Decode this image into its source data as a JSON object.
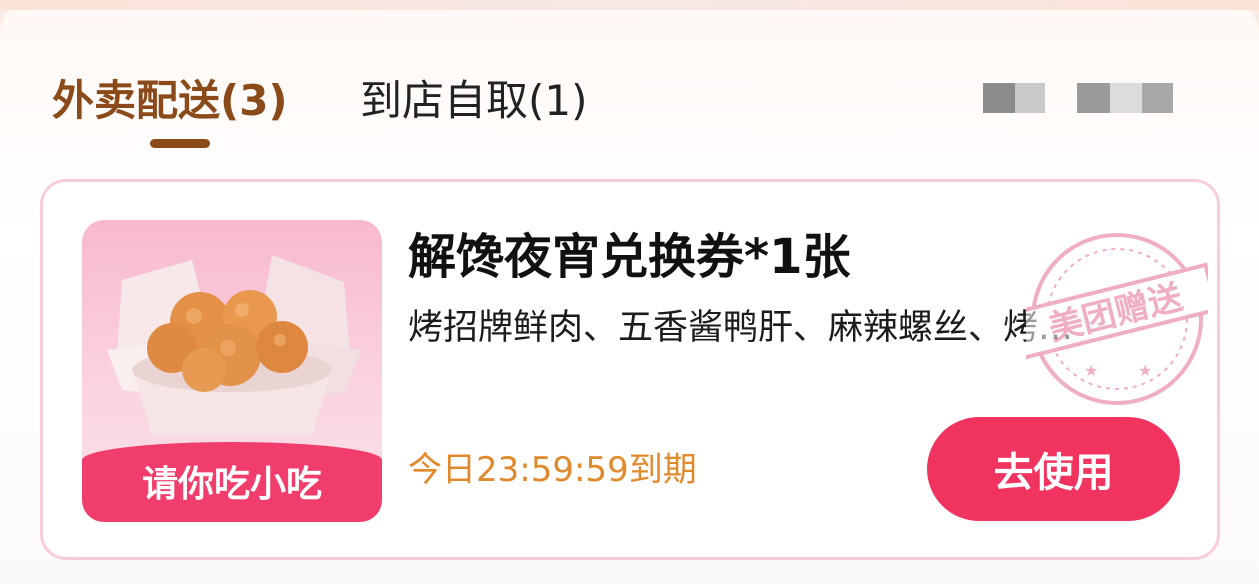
{
  "tabs": [
    {
      "label": "外卖配送(3)",
      "active": true
    },
    {
      "label": "到店自取(1)",
      "active": false
    }
  ],
  "coupon": {
    "image_label": "请你吃小吃",
    "title": "解馋夜宵兑换券*1张",
    "description": "烤招牌鲜肉、五香酱鸭肝、麻辣螺丝、烤…",
    "expiry": "今日23:59:59到期",
    "use_button": "去使用",
    "stamp_text": "美团赠送"
  },
  "colors": {
    "accent_brown": "#8a4a1a",
    "primary_pink": "#f1335f",
    "expiry_orange": "#e0892d",
    "card_border": "#f7cdd9"
  }
}
